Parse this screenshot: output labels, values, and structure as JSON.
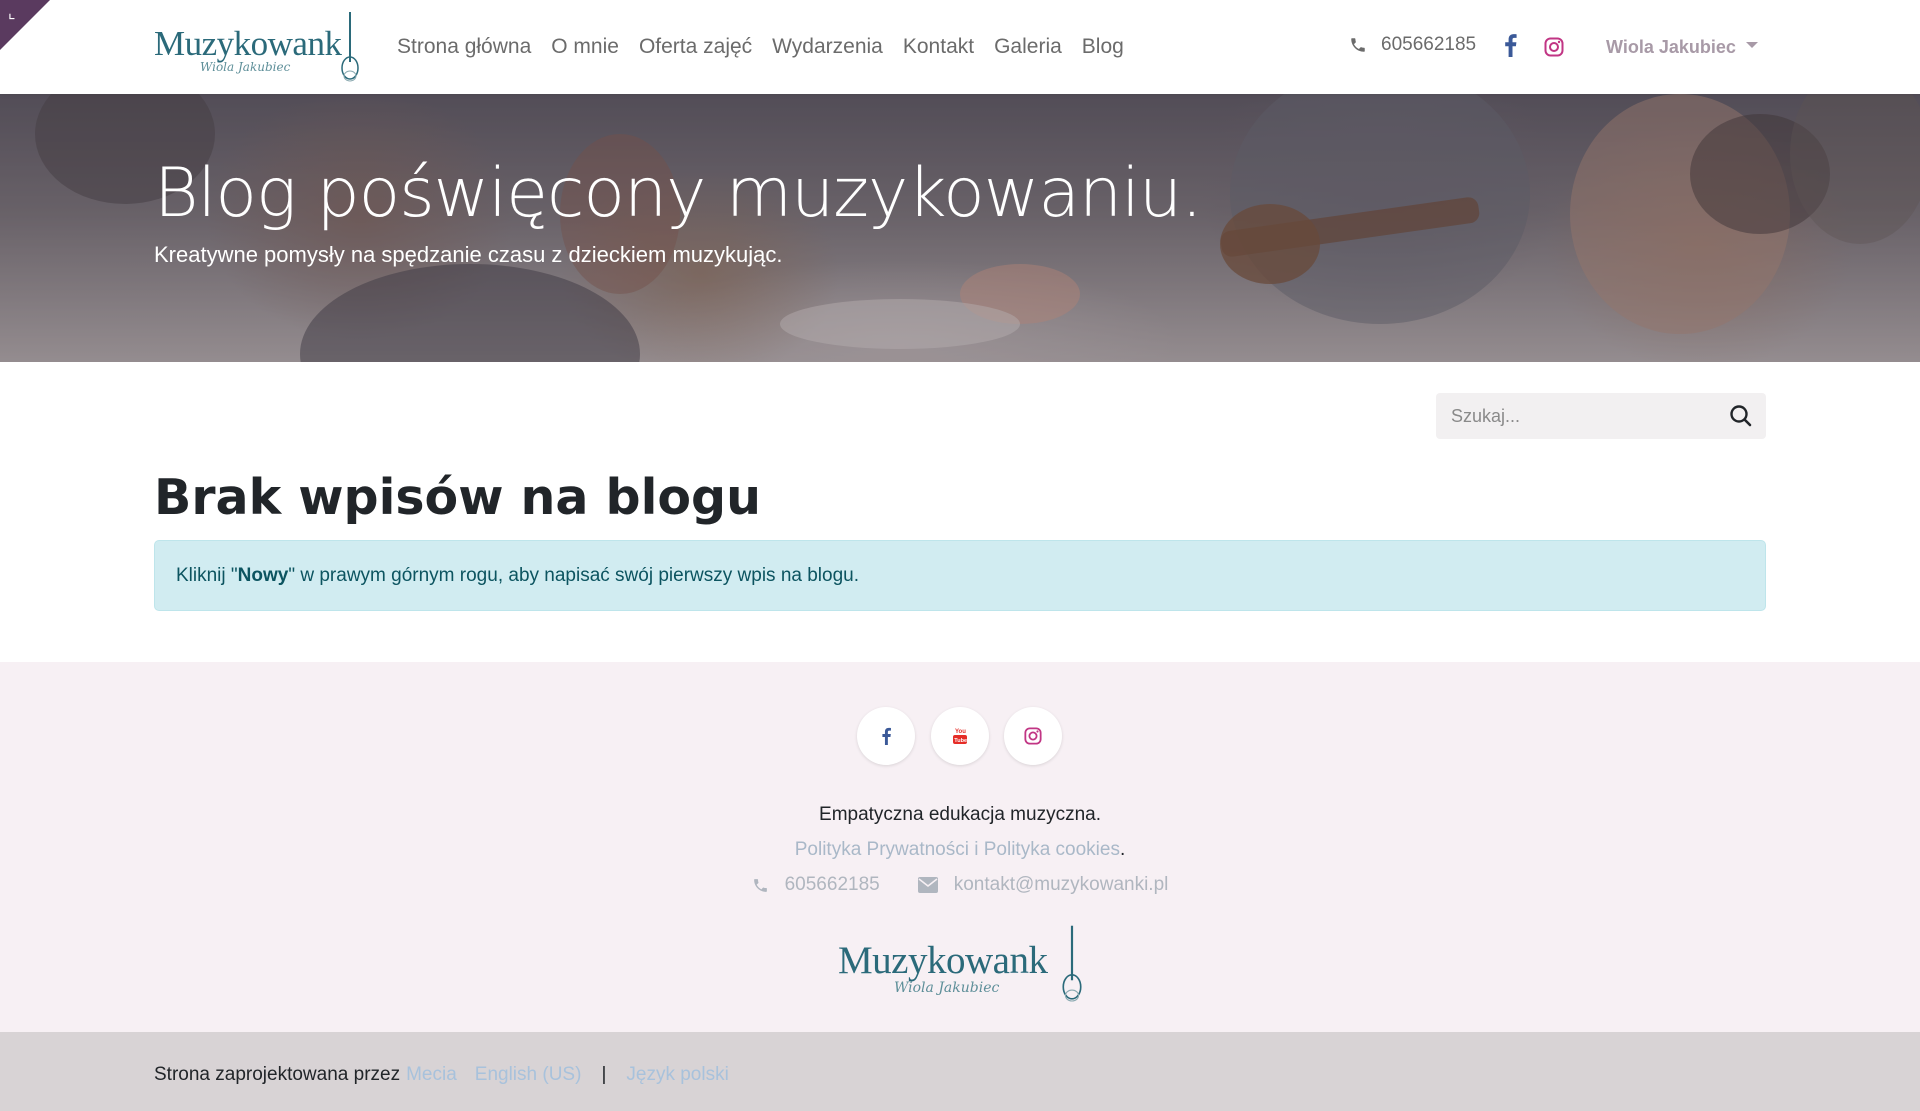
{
  "header": {
    "logo_text": "Muzykowank",
    "logo_sub": "Wiola Jakubiec",
    "nav": [
      "Strona główna",
      "O mnie",
      "Oferta zajęć",
      "Wydarzenia",
      "Kontakt",
      "Galeria",
      "Blog"
    ],
    "phone": "605662185",
    "user_name": "Wiola Jakubiec"
  },
  "hero": {
    "title": "Blog poświęcony muzykowaniu.",
    "subtitle": "Kreatywne pomysły na spędzanie czasu z dzieckiem muzykując."
  },
  "search": {
    "placeholder": "Szukaj..."
  },
  "main": {
    "heading": "Brak wpisów na blogu",
    "alert_prefix": "Kliknij \"",
    "alert_bold": "Nowy",
    "alert_suffix": "\" w prawym górnym rogu, aby napisać swój pierwszy wpis na blogu."
  },
  "footer": {
    "tagline": "Empatyczna edukacja muzyczna.",
    "policy_link": "Polityka Prywatności i Polityka cookies",
    "policy_dot": ".",
    "phone": "605662185",
    "email": "kontakt@muzykowanki.pl",
    "logo_text": "Muzykowank",
    "logo_sub": "Wiola Jakubiec"
  },
  "bottom": {
    "designed_by": "Strona zaprojektowana przez",
    "designer": "Mecia",
    "lang_en": "English (US)",
    "separator": "|",
    "lang_pl": "Język polski"
  },
  "colors": {
    "brand_teal": "#2b6a7a",
    "corner_purple": "#5a3a5f",
    "alert_bg": "#d1ecf1",
    "footer_bg": "#f7f0f4",
    "facebook": "#3b5998",
    "instagram": "#c13584",
    "youtube": "#e52d27"
  },
  "icons": [
    "phone-icon",
    "facebook-icon",
    "instagram-icon",
    "youtube-icon",
    "search-icon",
    "envelope-icon",
    "caret-down-icon"
  ]
}
